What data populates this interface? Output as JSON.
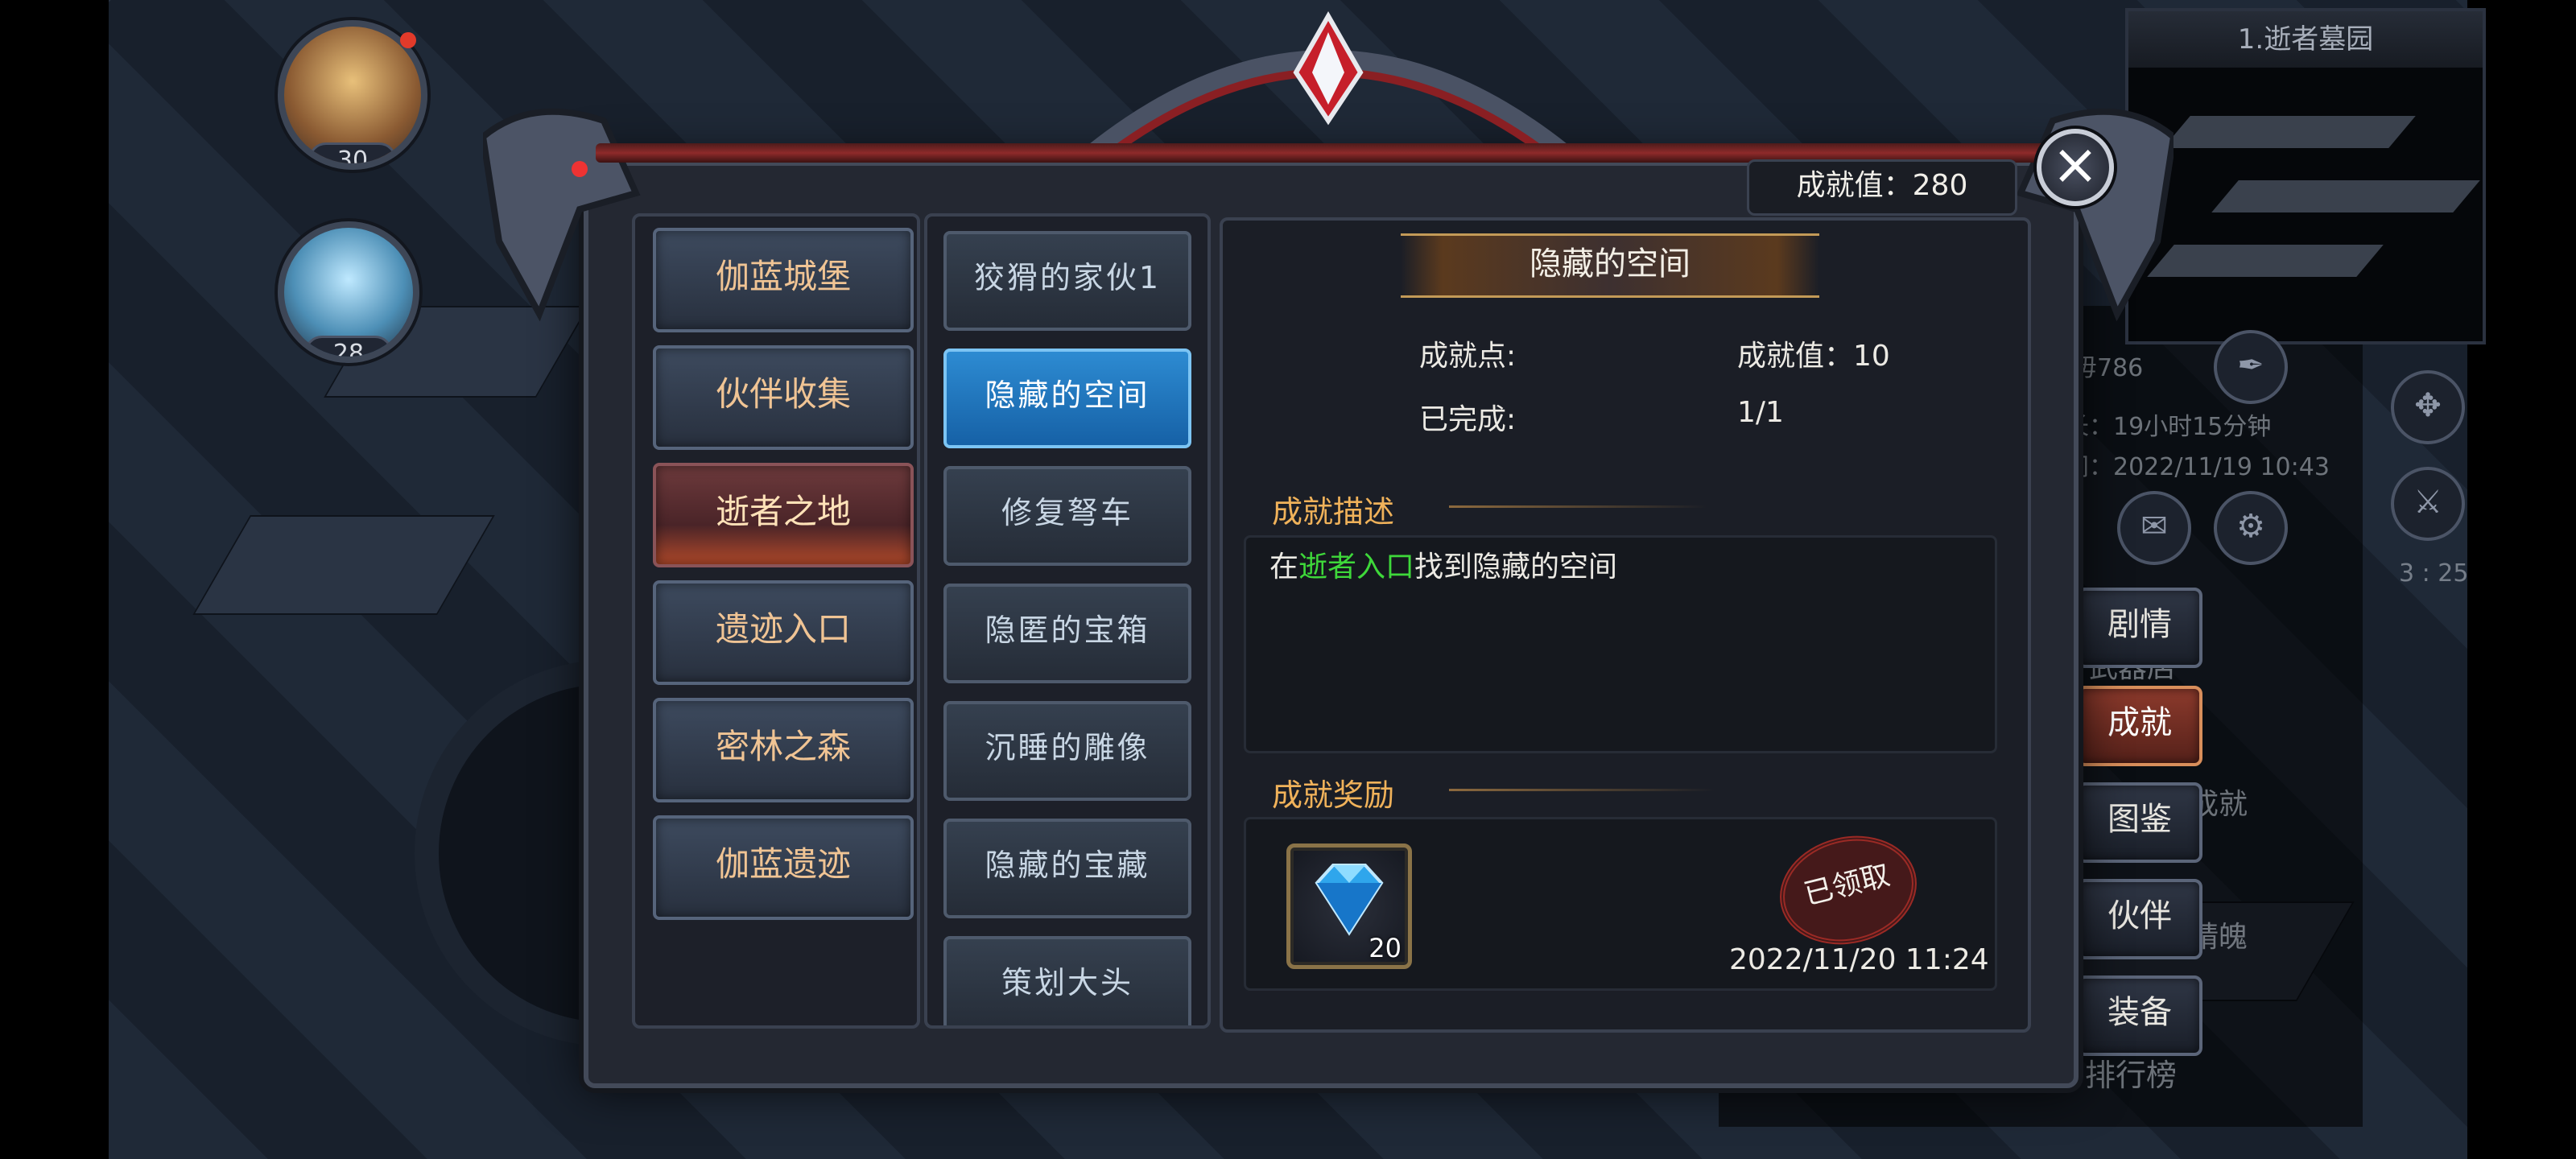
{
  "colors": {
    "accent_gold": "#f0b25a",
    "active_blue": "#1f74bd",
    "active_red": "#6d3a3c",
    "highlight_green": "#3ed83a"
  },
  "party": [
    {
      "level": "30"
    },
    {
      "level": "28"
    }
  ],
  "minimap": {
    "title": "1.逝者墓园"
  },
  "side_panel": {
    "name_fragment": "毋786",
    "line1": "长：19小时15分钟",
    "line2": "间：2022/11/19 10:43",
    "timer": "3 : 25",
    "ghost_items": [
      "武器店",
      "成就",
      "精魄",
      "排行榜"
    ],
    "tabs": [
      "剧情",
      "成就",
      "图鉴",
      "伙伴",
      "装备"
    ],
    "active_tab": "成就"
  },
  "dialog": {
    "score_label": "成就值：280",
    "close_icon": "close-icon",
    "categories": [
      "伽蓝城堡",
      "伙伴收集",
      "逝者之地",
      "遗迹入口",
      "密林之森",
      "伽蓝遗迹"
    ],
    "active_category": "逝者之地",
    "achievements": [
      "狡猾的家伙1",
      "隐藏的空间",
      "修复弩车",
      "隐匿的宝箱",
      "沉睡的雕像",
      "隐藏的宝藏",
      "策划大头"
    ],
    "active_achievement": "隐藏的空间",
    "detail": {
      "title": "隐藏的空间",
      "points_label": "成就点:",
      "points_value": "成就值：10",
      "done_label": "已完成:",
      "done_value": "1/1",
      "desc_heading": "成就描述",
      "desc_prefix": "在",
      "desc_highlight": "逝者入口",
      "desc_suffix": "找到隐藏的空间",
      "reward_heading": "成就奖励",
      "reward_icon": "diamond-icon",
      "reward_count": "20",
      "stamp_text": "已领取",
      "claim_time": "2022/11/20 11:24"
    }
  }
}
